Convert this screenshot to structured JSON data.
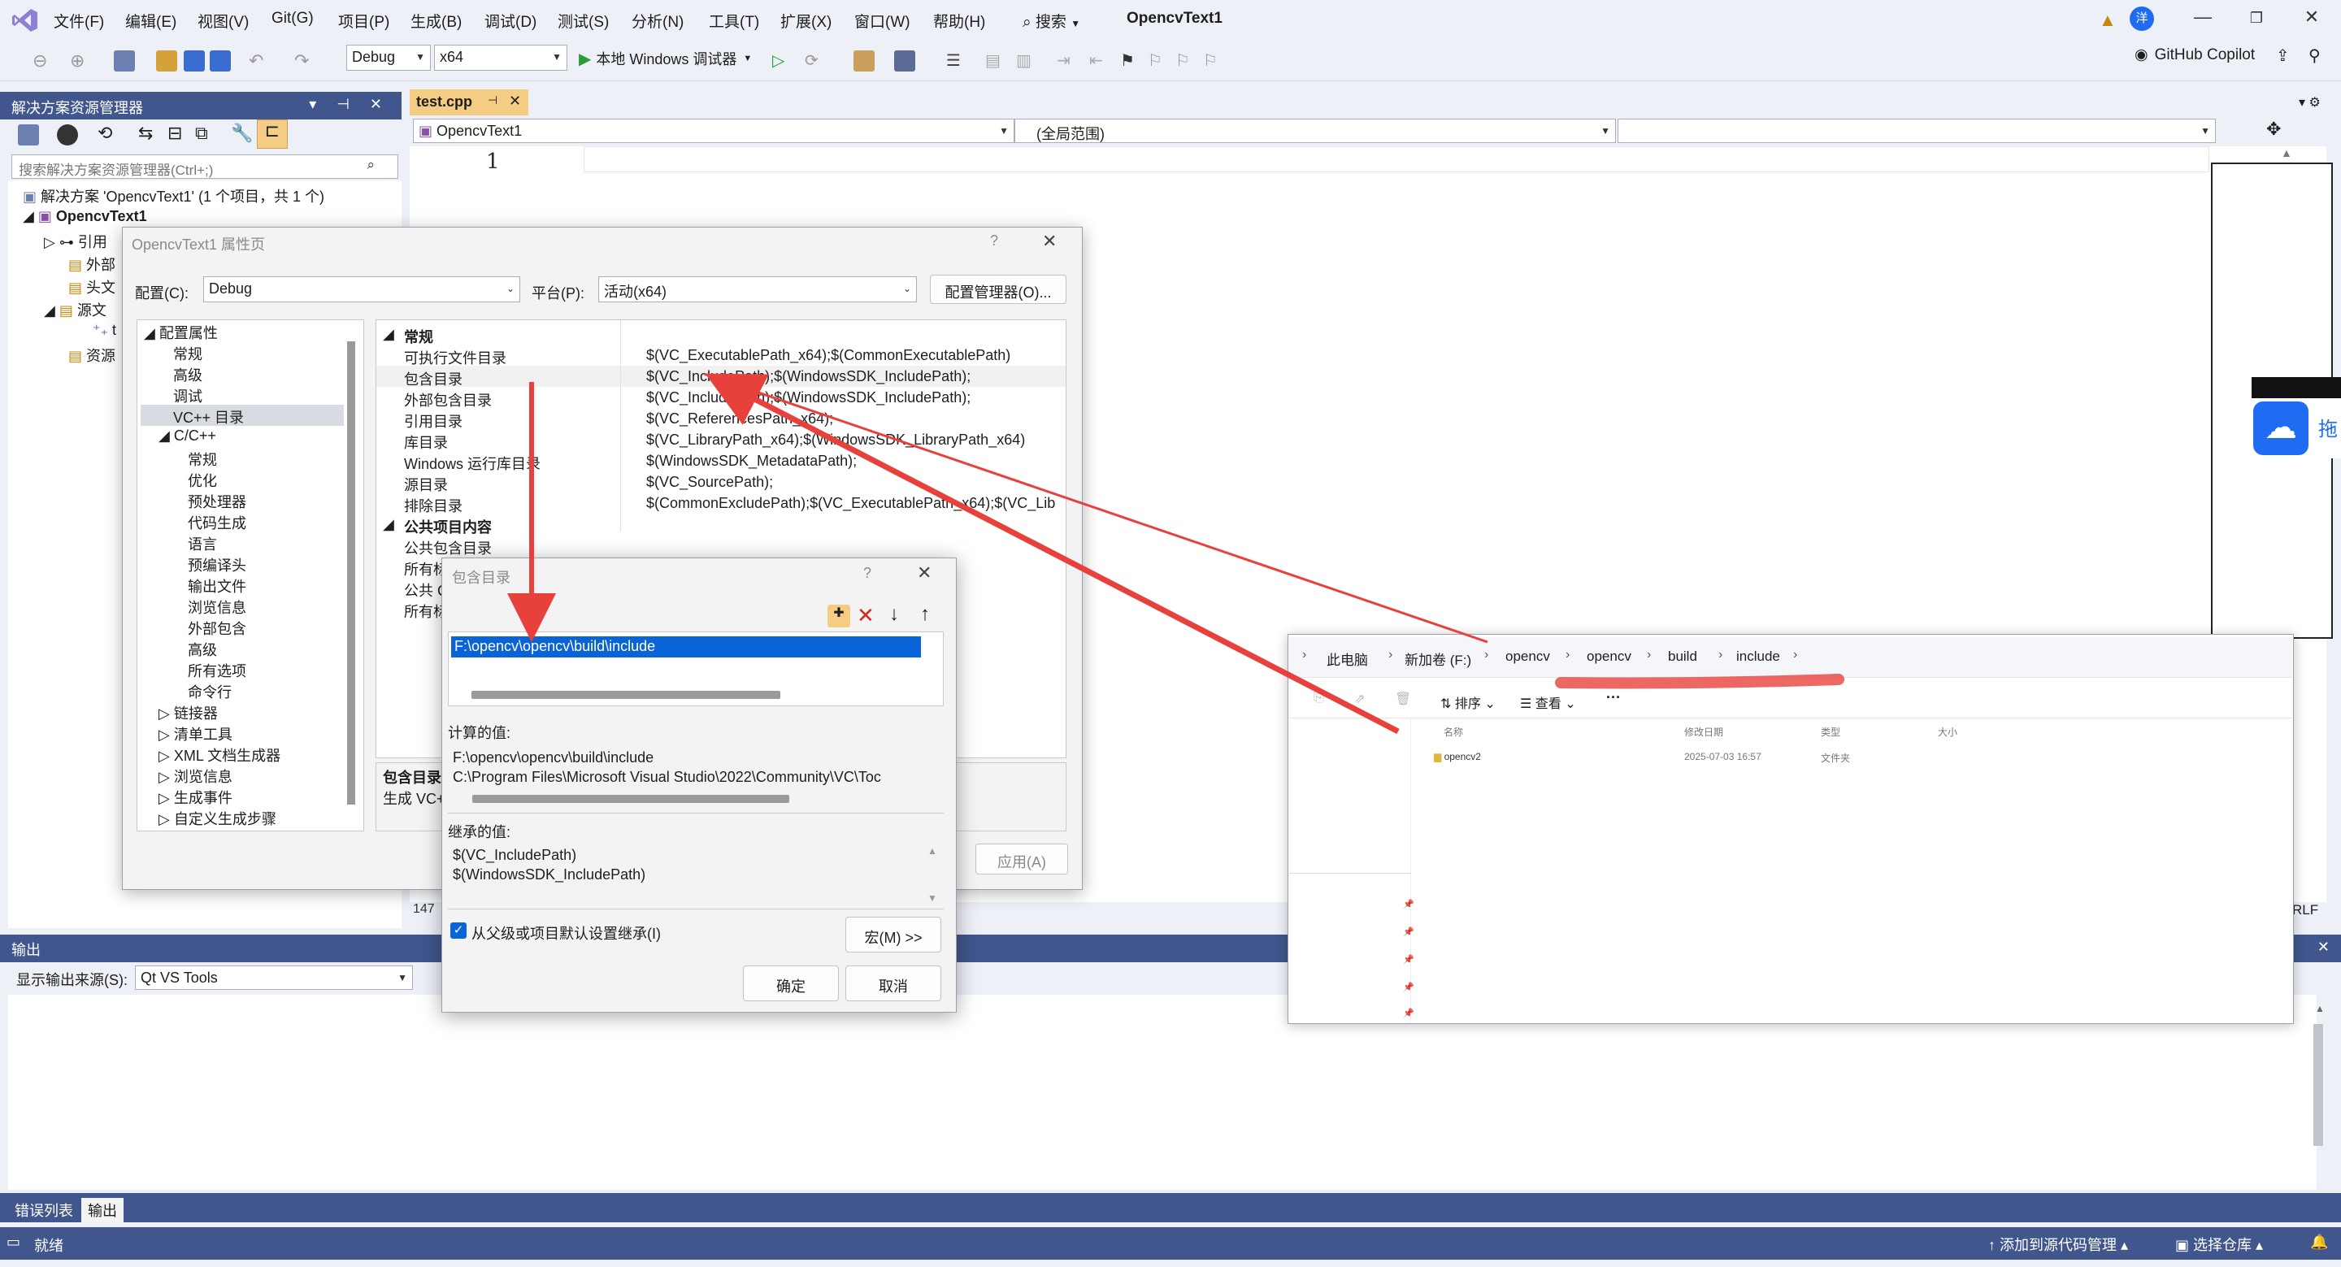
{
  "menu": {
    "items": [
      "文件(F)",
      "编辑(E)",
      "视图(V)",
      "Git(G)",
      "项目(P)",
      "生成(B)",
      "调试(D)",
      "测试(S)",
      "分析(N)",
      "工具(T)",
      "扩展(X)",
      "窗口(W)",
      "帮助(H)"
    ],
    "search_label": "搜索",
    "solution_name": "OpencvText1",
    "avatar_text": "洋"
  },
  "toolbar": {
    "config": "Debug",
    "platform": "x64",
    "run_label": "本地 Windows 调试器",
    "copilot": "GitHub Copilot"
  },
  "solution_explorer": {
    "title": "解决方案资源管理器",
    "search_placeholder": "搜索解决方案资源管理器(Ctrl+;)",
    "items": [
      "解决方案 'OpencvText1' (1 个项目，共 1 个)",
      "OpencvText1",
      "引用",
      "外部",
      "头文",
      "源文",
      "t",
      "资源"
    ]
  },
  "editor": {
    "tab_name": "test.cpp",
    "nav_project": "OpencvText1",
    "nav_scope": "(全局范围)",
    "line_number": "1",
    "status_line": "147",
    "crlf": "RLF"
  },
  "property_dialog": {
    "title": "OpencvText1 属性页",
    "help": "?",
    "config_label": "配置(C):",
    "config_value": "Debug",
    "platform_label": "平台(P):",
    "platform_value": "活动(x64)",
    "config_manager": "配置管理器(O)...",
    "apply": "应用(A)",
    "tree": [
      "配置属性",
      "常规",
      "高级",
      "调试",
      "VC++ 目录",
      "C/C++",
      "常规",
      "优化",
      "预处理器",
      "代码生成",
      "语言",
      "预编译头",
      "输出文件",
      "浏览信息",
      "外部包含",
      "高级",
      "所有选项",
      "命令行",
      "链接器",
      "清单工具",
      "XML 文档生成器",
      "浏览信息",
      "生成事件",
      "自定义生成步骤"
    ],
    "cat_general": "常规",
    "cat_public": "公共项目内容",
    "rows": [
      {
        "k": "可执行文件目录",
        "v": "$(VC_ExecutablePath_x64);$(CommonExecutablePath)"
      },
      {
        "k": "包含目录",
        "v": "$(VC_IncludePath);$(WindowsSDK_IncludePath);"
      },
      {
        "k": "外部包含目录",
        "v": "$(VC_IncludePath);$(WindowsSDK_IncludePath);"
      },
      {
        "k": "引用目录",
        "v": "$(VC_ReferencesPath_x64);"
      },
      {
        "k": "库目录",
        "v": "$(VC_LibraryPath_x64);$(WindowsSDK_LibraryPath_x64)"
      },
      {
        "k": "Windows 运行库目录",
        "v": "$(WindowsSDK_MetadataPath);"
      },
      {
        "k": "源目录",
        "v": "$(VC_SourcePath);"
      },
      {
        "k": "排除目录",
        "v": "$(CommonExcludePath);$(VC_ExecutablePath_x64);$(VC_Lib"
      }
    ],
    "public_rows": [
      "公共包含目录",
      "所有标",
      "公共 C",
      "所有标"
    ],
    "desc_title": "包含目录",
    "desc_text": "生成 VC++"
  },
  "include_dialog": {
    "title": "包含目录",
    "help": "?",
    "entry": "F:\\opencv\\opencv\\build\\include",
    "calc_label": "计算的值:",
    "calc_lines": [
      "F:\\opencv\\opencv\\build\\include",
      "C:\\Program Files\\Microsoft Visual Studio\\2022\\Community\\VC\\Toc"
    ],
    "inherit_label": "继承的值:",
    "inherit_lines": [
      "$(VC_IncludePath)",
      "$(WindowsSDK_IncludePath)"
    ],
    "inherit_check": "从父级或项目默认设置继承(I)",
    "macro": "宏(M) >>",
    "ok": "确定",
    "cancel": "取消"
  },
  "output": {
    "title": "输出",
    "source_label": "显示输出来源(S):",
    "source_value": "Qt VS Tools",
    "tab_errors": "错误列表",
    "tab_output": "输出"
  },
  "statusbar": {
    "ready": "就绪",
    "add_source": "添加到源代码管理",
    "select_repo": "选择仓库"
  },
  "explorer": {
    "crumbs": [
      "此电脑",
      "新加卷 (F:)",
      "opencv",
      "opencv",
      "build",
      "include"
    ],
    "sort": "排序",
    "view": "查看",
    "more": "···",
    "cols": [
      "名称",
      "修改日期",
      "类型",
      "大小"
    ],
    "file": {
      "name": "opencv2",
      "date": "2025-07-03 16:57",
      "type": "文件夹"
    }
  },
  "baidu": {
    "text": "拖"
  },
  "colors": {
    "accent": "#40568d",
    "selection": "#0a64d8",
    "tab": "#f5cc84",
    "arrow": "#e8413c"
  }
}
